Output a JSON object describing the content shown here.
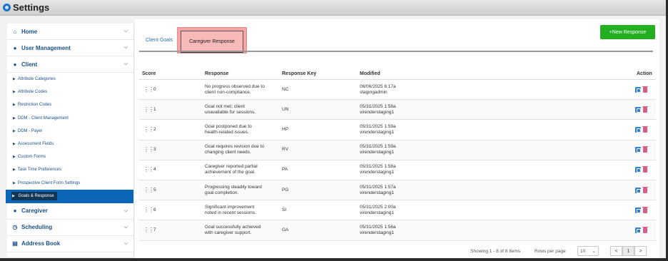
{
  "window": {
    "title": "Settings"
  },
  "sidebar": {
    "sections": [
      {
        "label": "Home",
        "icon": "home-icon"
      },
      {
        "label": "User Management",
        "icon": "user-icon"
      },
      {
        "label": "Client",
        "icon": "user-icon"
      }
    ],
    "client_items": [
      "Attribute Categories",
      "Attribute Codes",
      "Restriction Codes",
      "DDM - Client Management",
      "DDM - Payer",
      "Assessment Fields",
      "Custom Forms",
      "Task Time Preferences",
      "Prospective Client Form Settings",
      "Goals & Response"
    ],
    "active_item": "Goals & Response",
    "bottom_sections": [
      {
        "label": "Caregiver",
        "icon": "user-icon"
      },
      {
        "label": "Scheduling",
        "icon": "clock-icon"
      },
      {
        "label": "Address Book",
        "icon": "chart-icon"
      }
    ]
  },
  "tabs": {
    "goals": "Client Goals",
    "response": "Caregiver Response",
    "active": "Caregiver Response"
  },
  "new_button": "+New Response",
  "table": {
    "headers": {
      "score": "Score",
      "response": "Response",
      "key": "Response Key",
      "modified": "Modified",
      "action": "Action"
    },
    "rows": [
      {
        "score": "0",
        "response_l1": "No progress observed due to",
        "response_l2": "client non-compliance.",
        "key": "NC",
        "mod_l1": "06/06/2025 6:17a",
        "mod_l2": "stagingadmin"
      },
      {
        "score": "1",
        "response_l1": "Goal not met; client",
        "response_l2": "unavailable for sessions.",
        "key": "UN",
        "mod_l1": "05/31/2025 1:58a",
        "mod_l2": "virenderstaging1"
      },
      {
        "score": "2",
        "response_l1": "Goal postponed due to",
        "response_l2": "health-related issues.",
        "key": "HP",
        "mod_l1": "05/31/2025 1:59a",
        "mod_l2": "virenderstaging1"
      },
      {
        "score": "3",
        "response_l1": "Goal requires revision due to",
        "response_l2": "changing client needs.",
        "key": "RV",
        "mod_l1": "05/31/2025 1:59a",
        "mod_l2": "virenderstaging1"
      },
      {
        "score": "4",
        "response_l1": "Caregiver reported partial",
        "response_l2": "achievement of the goal.",
        "key": "PA",
        "mod_l1": "05/31/2025 1:58a",
        "mod_l2": "virenderstaging1"
      },
      {
        "score": "5",
        "response_l1": "Progressing steadily toward",
        "response_l2": "goal completion.",
        "key": "PG",
        "mod_l1": "05/31/2025 1:57a",
        "mod_l2": "virenderstaging1"
      },
      {
        "score": "6",
        "response_l1": "Significant improvement",
        "response_l2": "noted in recent sessions.",
        "key": "SI",
        "mod_l1": "05/31/2025 2:00a",
        "mod_l2": "virenderstaging1"
      },
      {
        "score": "7",
        "response_l1": "Goal successfully achieved",
        "response_l2": "with caregiver support.",
        "key": "GA",
        "mod_l1": "05/31/2025 1:56a",
        "mod_l2": "virenderstaging1"
      }
    ]
  },
  "footer": {
    "showing": "Showing 1 - 8 of 8 Items",
    "rows_per_page_label": "Rows per page",
    "rows_per_page_value": "10",
    "page_prev": "<",
    "page_current": "1",
    "page_next": ">"
  },
  "colors": {
    "primary": "#0b66b8",
    "new_button": "#22b022",
    "tab_highlight": "#f4a4a4",
    "edit": "#2f7fd6",
    "delete": "#d65f8a"
  }
}
